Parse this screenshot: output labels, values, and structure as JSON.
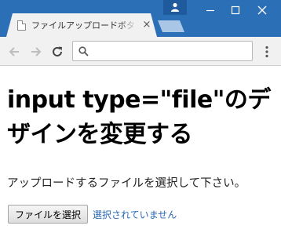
{
  "browser": {
    "tab_title": "ファイルアップロードボタンのデザイン",
    "tab_close": "×",
    "omnibox_value": "",
    "colors": {
      "titlebar": "#2b6fb6",
      "toolbar": "#f1f1f1",
      "link": "#2a6ab5"
    }
  },
  "page": {
    "heading": "input type=\"file\"のデザインを変更する",
    "description": "アップロードするファイルを選択して下さい。",
    "file_button_label": "ファイルを選択",
    "file_status": "選択されていません"
  }
}
